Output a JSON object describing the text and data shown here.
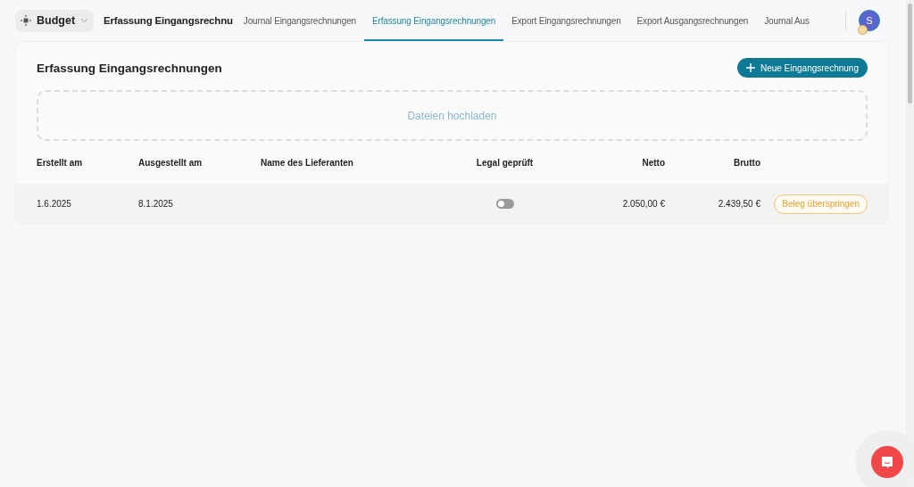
{
  "workspace": {
    "label": "Budget"
  },
  "page_title": "Erfassung Eingangsrechnu",
  "tabs": [
    {
      "label": "Journal Eingangsrechnungen",
      "selected": false
    },
    {
      "label": "Erfassung Eingangsrechnungen",
      "selected": true
    },
    {
      "label": "Export Eingangsrechnungen",
      "selected": false
    },
    {
      "label": "Export Ausgangsrechnungen",
      "selected": false
    },
    {
      "label": "Journal Aus",
      "selected": false
    }
  ],
  "user": {
    "initial": "S"
  },
  "card": {
    "title": "Erfassung Eingangsrechnungen",
    "new_button": "Neue Eingangsrechnung",
    "upload": "Dateien hochladen"
  },
  "table": {
    "columns": [
      "Erstellt am",
      "Ausgestellt am",
      "Name des Lieferanten",
      "Legal geprüft",
      "Netto",
      "Brutto"
    ],
    "rows": [
      {
        "created": "1.6.2025",
        "issued": "8.1.2025",
        "supplier_name": "",
        "legal_checked": false,
        "net": "2.050,00 €",
        "gross": "2.439,50 €",
        "action": "Beleg überspringen"
      }
    ]
  }
}
